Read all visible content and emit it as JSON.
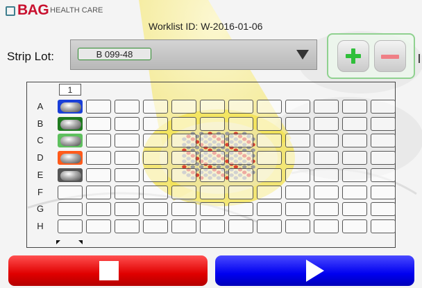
{
  "logo": {
    "brand": "BAG",
    "tagline": "HEALTH CARE"
  },
  "worklist": {
    "label": "Worklist ID: W-2016-01-06"
  },
  "strip_lot": {
    "label": "Strip Lot:",
    "value": "B 099-48"
  },
  "grid": {
    "column_header": "1",
    "rows": [
      "A",
      "B",
      "C",
      "D",
      "E",
      "F",
      "G",
      "H"
    ],
    "columns": 12,
    "loaded_wells": [
      {
        "row": "A",
        "border_color": "#1a3fd8"
      },
      {
        "row": "B",
        "border_color": "#1f7a1f"
      },
      {
        "row": "C",
        "border_color": "#5ec05e"
      },
      {
        "row": "D",
        "border_color": "#ff5a1a"
      },
      {
        "row": "E",
        "border_color": "#555555"
      }
    ]
  },
  "icons": {
    "add": "plus-icon",
    "remove": "minus-icon",
    "dropdown": "triangle-down-icon",
    "stop": "stop-icon",
    "start": "play-icon"
  },
  "colors": {
    "stop": "#e00000",
    "start": "#0000f0",
    "plus": "#2fbf3a",
    "minus": "#ef7f86"
  }
}
